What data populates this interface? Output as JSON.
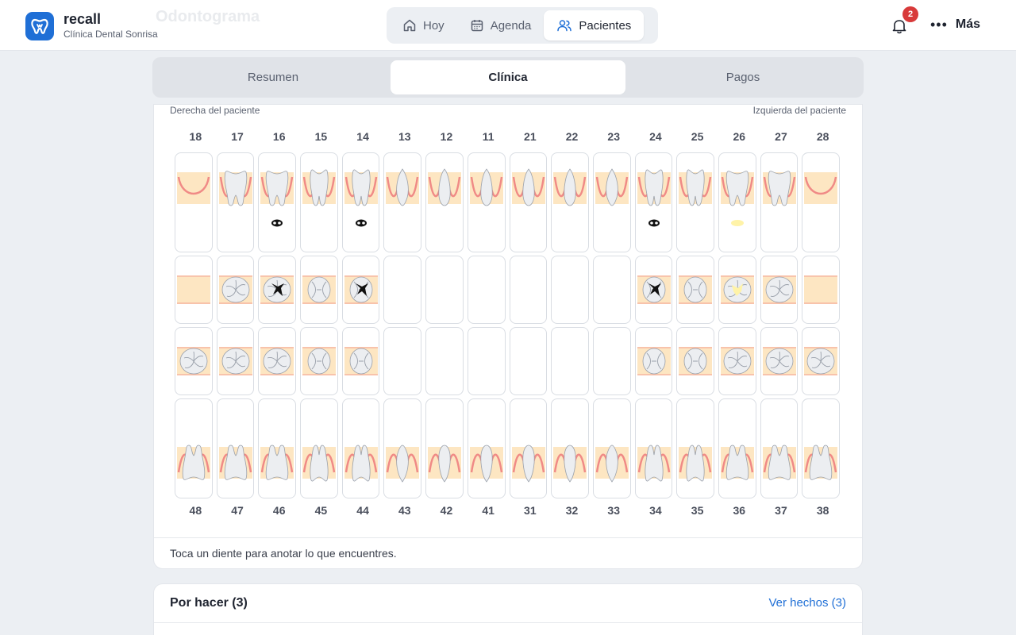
{
  "app": {
    "name": "recall",
    "clinic": "Clínica Dental Sonrisa",
    "accent": "#1f6fd6"
  },
  "ghost_title": "Odontograma",
  "nav": {
    "items": [
      {
        "label": "Hoy",
        "icon": "home-icon"
      },
      {
        "label": "Agenda",
        "icon": "calendar-icon"
      },
      {
        "label": "Pacientes",
        "icon": "users-icon",
        "active": true
      }
    ]
  },
  "header": {
    "notification_count": "2",
    "more_label": "Más"
  },
  "tabs": [
    {
      "label": "Resumen"
    },
    {
      "label": "Clínica",
      "active": true
    },
    {
      "label": "Pagos"
    }
  ],
  "odontogram": {
    "right_label": "Derecha del paciente",
    "left_label": "Izquierda del paciente",
    "upper_numbers": [
      "18",
      "17",
      "16",
      "15",
      "14",
      "13",
      "12",
      "11",
      "21",
      "22",
      "23",
      "24",
      "25",
      "26",
      "27",
      "28"
    ],
    "lower_numbers": [
      "48",
      "47",
      "46",
      "45",
      "44",
      "43",
      "42",
      "41",
      "31",
      "32",
      "33",
      "34",
      "35",
      "36",
      "37",
      "38"
    ],
    "upper_teeth": [
      "missing",
      "molar",
      "molar-caries",
      "premolar",
      "premolar-caries",
      "canine",
      "incisor",
      "incisor",
      "incisor",
      "incisor",
      "canine",
      "premolar-caries",
      "premolar",
      "molar-filling",
      "molar",
      "missing"
    ],
    "upper_occlusal": [
      "missing",
      "molar",
      "molar-caries",
      "premolar",
      "premolar-caries",
      "none",
      "none",
      "none",
      "none",
      "none",
      "none",
      "premolar-caries",
      "premolar",
      "molar-filling",
      "molar",
      "missing"
    ],
    "lower_occlusal": [
      "molar",
      "molar",
      "molar",
      "premolar",
      "premolar",
      "none",
      "none",
      "none",
      "none",
      "none",
      "none",
      "premolar",
      "premolar",
      "molar",
      "molar",
      "molar"
    ],
    "lower_teeth": [
      "molar",
      "molar",
      "molar",
      "premolar",
      "premolar",
      "canine",
      "incisor",
      "incisor",
      "incisor",
      "incisor",
      "canine",
      "premolar",
      "premolar",
      "molar",
      "molar",
      "molar"
    ],
    "hint": "Toca un diente para anotar lo que encuentres."
  },
  "tasks": {
    "title": "Por hacer (3)",
    "link": "Ver hechos (3)"
  }
}
